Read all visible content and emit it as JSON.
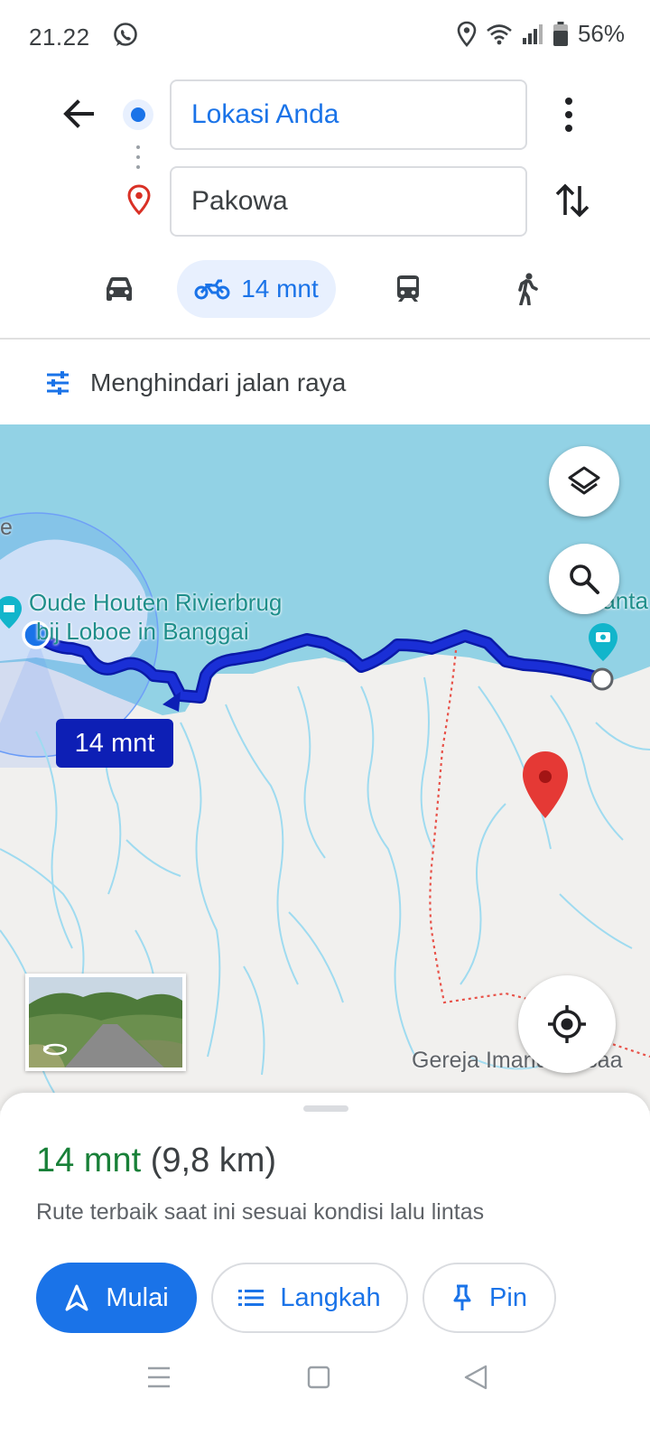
{
  "status_bar": {
    "time": "21.22",
    "battery": "56%",
    "icons": [
      "whatsapp-icon",
      "location-icon",
      "wifi-icon",
      "signal-icon",
      "battery-icon"
    ]
  },
  "header": {
    "origin": "Lokasi Anda",
    "destination": "Pakowa",
    "icons": [
      "back-arrow-icon",
      "more-vertical-icon",
      "swap-icon",
      "origin-dot-icon",
      "destination-pin-icon"
    ]
  },
  "modes": {
    "selected": "motorcycle",
    "motorcycle_time": "14 mnt",
    "icons": [
      "car-icon",
      "motorcycle-icon",
      "transit-icon",
      "walk-icon"
    ]
  },
  "options": {
    "label": "Menghindari jalan raya",
    "icon": "tune-icon"
  },
  "map": {
    "poi_name_line1": "Oude Houten Rivierbrug",
    "poi_name_line2": "bij Loboe in Banggai",
    "route_time_label": "14 mnt",
    "church_label": "Gereja Imanuel Asaa",
    "edge_label_left": "e",
    "edge_label_right": "Panta",
    "colors": {
      "water": "#92d2e5",
      "land": "#f1f0ee",
      "route": "#1a2fd6",
      "river": "#9fdbf0",
      "border": "#e8534a",
      "pin": "#e53935"
    }
  },
  "sheet": {
    "duration": "14 mnt",
    "distance": "(9,8 km)",
    "description": "Rute terbaik saat ini sesuai kondisi lalu lintas",
    "start_label": "Mulai",
    "steps_label": "Langkah",
    "pin_label": "Pin",
    "colors": {
      "primary": "#1a73e8",
      "duration": "#188038"
    }
  }
}
